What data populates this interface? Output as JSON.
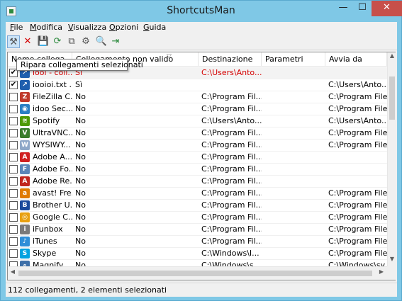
{
  "window": {
    "title": "ShortcutsMan",
    "minimize": "—",
    "maximize": "☐",
    "close": "✕"
  },
  "menu": [
    {
      "label": "File",
      "u": "F",
      "rest": "ile"
    },
    {
      "label": "Modifica",
      "u": "M",
      "rest": "odifica"
    },
    {
      "label": "Visualizza",
      "u": "V",
      "rest": "isualizza"
    },
    {
      "label": "Opzioni",
      "u": "O",
      "rest": "pzioni"
    },
    {
      "label": "Guida",
      "u": "G",
      "rest": "uida"
    }
  ],
  "toolbar": {
    "buttons": [
      {
        "name": "fix-shortcuts-icon",
        "glyph": "⚒",
        "color": "#555555"
      },
      {
        "name": "delete-icon",
        "glyph": "✕",
        "color": "#d40000"
      },
      {
        "name": "save-icon",
        "glyph": "💾",
        "color": "#2a4f8a"
      },
      {
        "name": "refresh-icon",
        "glyph": "⟳",
        "color": "#2d8a3e"
      },
      {
        "name": "copy-icon",
        "glyph": "⧉",
        "color": "#555555"
      },
      {
        "name": "properties-icon",
        "glyph": "⚙",
        "color": "#555555"
      },
      {
        "name": "find-icon",
        "glyph": "🔍",
        "color": "#2a4f8a"
      },
      {
        "name": "exit-icon",
        "glyph": "⇥",
        "color": "#2d8a3e"
      }
    ]
  },
  "tooltip": "Ripara collegamenti selezionati",
  "columns": {
    "name": "Nome collega...",
    "broken": "Collegamento non valido",
    "destination": "Destinazione",
    "parameters": "Parametri",
    "start_in": "Avvia da"
  },
  "rows": [
    {
      "checked": true,
      "icon": "shortcut-icon",
      "icon_color": "#1f5fae",
      "icon_glyph": "↗",
      "name": "iooi - coll...",
      "broken": "Sì",
      "destination": "C:\\Users\\Anto...",
      "start_in": "",
      "red": true
    },
    {
      "checked": true,
      "icon": "shortcut-icon",
      "icon_color": "#1f5fae",
      "icon_glyph": "↗",
      "name": "iooioi.txt ...",
      "broken": "Sì",
      "destination": "",
      "start_in": "C:\\Users\\Anto...",
      "red": false
    },
    {
      "checked": false,
      "icon": "filezilla-icon",
      "icon_color": "#c0392b",
      "icon_glyph": "Z",
      "name": "FileZilla C...",
      "broken": "No",
      "destination": "C:\\Program Fil...",
      "start_in": "C:\\Program File...",
      "red": false
    },
    {
      "checked": false,
      "icon": "idoo-icon",
      "icon_color": "#2a7fc4",
      "icon_glyph": "◉",
      "name": "idoo Sec...",
      "broken": "No",
      "destination": "C:\\Program Fil...",
      "start_in": "C:\\Program File...",
      "red": false
    },
    {
      "checked": false,
      "icon": "spotify-icon",
      "icon_color": "#4e9a06",
      "icon_glyph": "≋",
      "name": "Spotify",
      "broken": "No",
      "destination": "C:\\Users\\Anto...",
      "start_in": "C:\\Users\\Anto...",
      "red": false
    },
    {
      "checked": false,
      "icon": "ultravnc-icon",
      "icon_color": "#3a7d2c",
      "icon_glyph": "V",
      "name": "UltraVNC...",
      "broken": "No",
      "destination": "C:\\Program Fil...",
      "start_in": "C:\\Program File...",
      "red": false
    },
    {
      "checked": false,
      "icon": "wysiwyg-icon",
      "icon_color": "#8fa8c8",
      "icon_glyph": "W",
      "name": "WYSIWY...",
      "broken": "No",
      "destination": "C:\\Program Fil...",
      "start_in": "C:\\Program File...",
      "red": false
    },
    {
      "checked": false,
      "icon": "adobe-icon",
      "icon_color": "#d02020",
      "icon_glyph": "A",
      "name": "Adobe A...",
      "broken": "No",
      "destination": "C:\\Program Fil...",
      "start_in": "",
      "red": false
    },
    {
      "checked": false,
      "icon": "adobe-form-icon",
      "icon_color": "#5c86b8",
      "icon_glyph": "F",
      "name": "Adobe Fo...",
      "broken": "No",
      "destination": "C:\\Program Fil...",
      "start_in": "",
      "red": false
    },
    {
      "checked": false,
      "icon": "adobe-reader-icon",
      "icon_color": "#c0261e",
      "icon_glyph": "A",
      "name": "Adobe Re...",
      "broken": "No",
      "destination": "C:\\Program Fil...",
      "start_in": "",
      "red": false
    },
    {
      "checked": false,
      "icon": "avast-icon",
      "icon_color": "#e07b00",
      "icon_glyph": "a",
      "name": "avast! Fre...",
      "broken": "No",
      "destination": "C:\\Program Fil...",
      "start_in": "C:\\Program File...",
      "red": false
    },
    {
      "checked": false,
      "icon": "brother-icon",
      "icon_color": "#1a4a9c",
      "icon_glyph": "B",
      "name": "Brother U...",
      "broken": "No",
      "destination": "C:\\Program Fil...",
      "start_in": "C:\\Program File...",
      "red": false
    },
    {
      "checked": false,
      "icon": "chrome-icon",
      "icon_color": "#e8a010",
      "icon_glyph": "◎",
      "name": "Google C...",
      "broken": "No",
      "destination": "C:\\Program Fil...",
      "start_in": "C:\\Program File...",
      "red": false
    },
    {
      "checked": false,
      "icon": "ifunbox-icon",
      "icon_color": "#7a7a7a",
      "icon_glyph": "i",
      "name": "iFunbox",
      "broken": "No",
      "destination": "C:\\Program Fil...",
      "start_in": "C:\\Program File...",
      "red": false
    },
    {
      "checked": false,
      "icon": "itunes-icon",
      "icon_color": "#2f8fd8",
      "icon_glyph": "♪",
      "name": "iTunes",
      "broken": "No",
      "destination": "C:\\Program Fil...",
      "start_in": "C:\\Program File...",
      "red": false
    },
    {
      "checked": false,
      "icon": "skype-icon",
      "icon_color": "#00a3e0",
      "icon_glyph": "S",
      "name": "Skype",
      "broken": "No",
      "destination": "C:\\Windows\\I...",
      "start_in": "C:\\Program File...",
      "red": false
    },
    {
      "checked": false,
      "icon": "magnify-icon",
      "icon_color": "#3d6fa8",
      "icon_glyph": "⌕",
      "name": "Magnify",
      "broken": "No",
      "destination": "C:\\Windows\\s...",
      "start_in": "C:\\Windows\\sy...",
      "red": false
    }
  ],
  "scrollbars": {
    "up": "▲",
    "down": "▼",
    "left": "◀",
    "right": "▶"
  },
  "status": "112 collegamenti, 2 elementi selezionati"
}
